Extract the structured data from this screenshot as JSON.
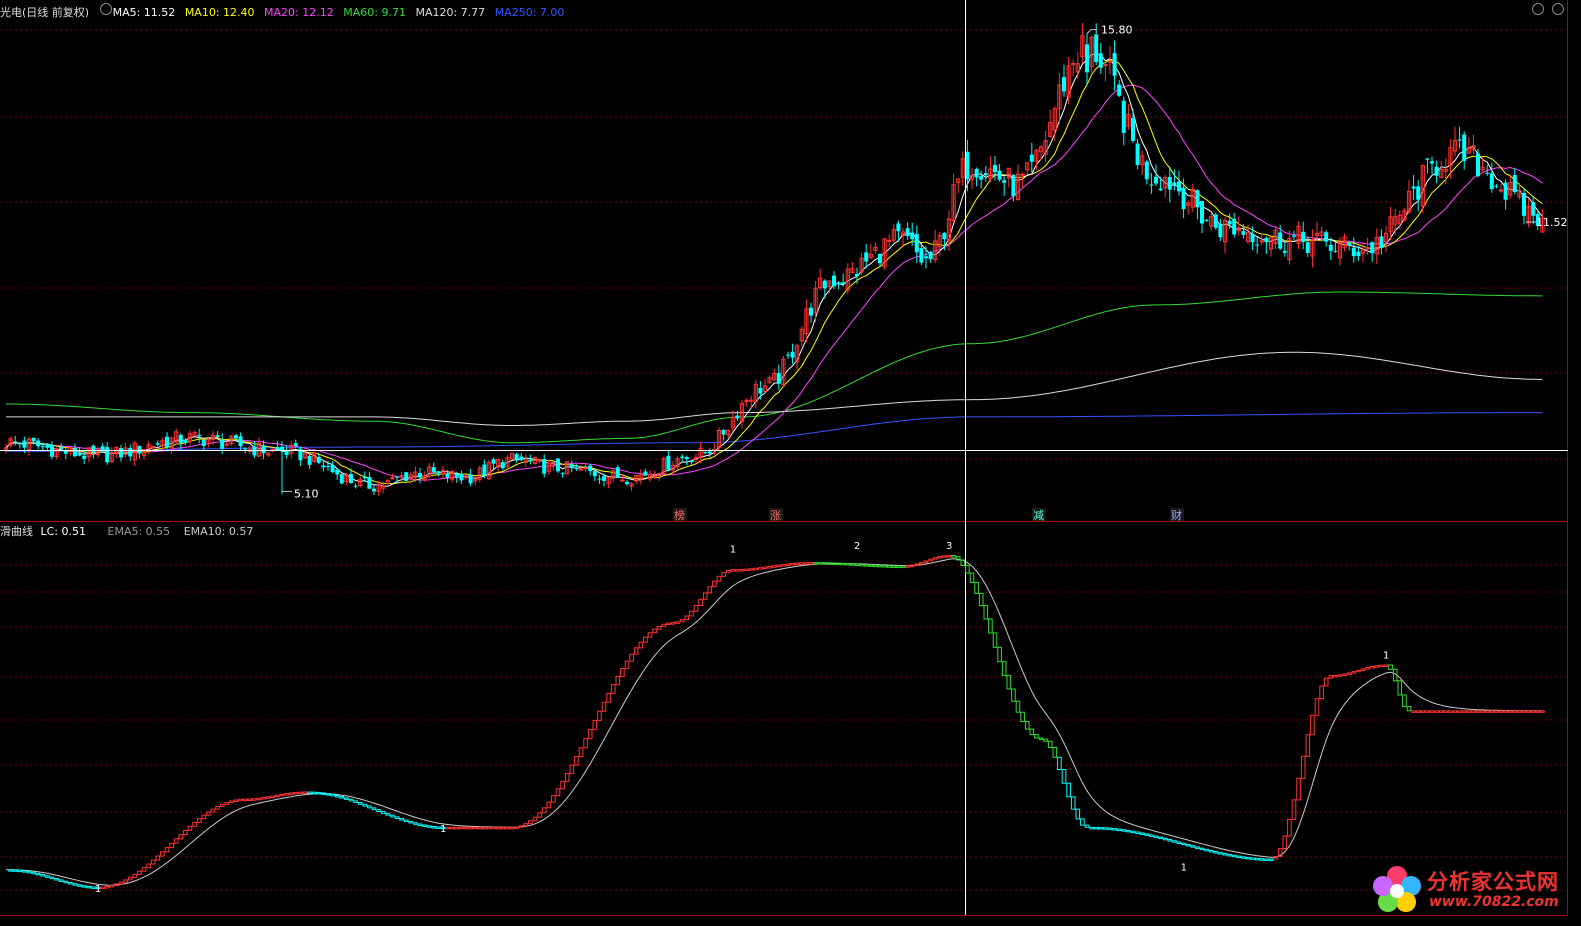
{
  "header": {
    "title": "光电(日线 前复权)",
    "ma": [
      {
        "label": "MA5: 11.52",
        "color": "#ffffff"
      },
      {
        "label": "MA10: 12.40",
        "color": "#ffff00"
      },
      {
        "label": "MA20: 12.12",
        "color": "#ff44ff"
      },
      {
        "label": "MA60: 9.71",
        "color": "#33dd33"
      },
      {
        "label": "MA120: 7.77",
        "color": "#dddddd"
      },
      {
        "label": "MA250: 7.00",
        "color": "#3355ff"
      }
    ]
  },
  "indicator": {
    "title": "滑曲线",
    "lc": "LC: 0.51",
    "ema5": "EMA5: 0.55",
    "ema10": "EMA10: 0.57"
  },
  "annotations": {
    "high": "15.80",
    "low": "5.10",
    "last": "11.52",
    "events": [
      "榜",
      "涨",
      "减",
      "财"
    ],
    "peaks": [
      "1",
      "2",
      "3",
      "1"
    ],
    "troughs": [
      "1",
      "1",
      "1"
    ]
  },
  "watermark": {
    "name": "分析家公式网",
    "url": "www.70822.com"
  },
  "colors": {
    "up": "#ff3333",
    "down": "#00ffff",
    "bg": "#000000",
    "grid": "#7a0000",
    "ma5": "#ffffff",
    "ma10": "#ffff00",
    "ma20": "#ff44ff",
    "ma60": "#33dd33",
    "ma120": "#dddddd",
    "ma250": "#3355ff",
    "osc_up": "#ff3333",
    "osc_down_green": "#33dd33",
    "osc_down_cyan": "#00ffff",
    "ema": "#cccccc"
  },
  "chart_data": {
    "type": "candlestick",
    "price_anchors": {
      "x": [
        0,
        20,
        40,
        60,
        80,
        90,
        100,
        110,
        120,
        135,
        150,
        165,
        180,
        195,
        200,
        210,
        220,
        235,
        250,
        265,
        280,
        295,
        315,
        335
      ],
      "close": [
        6.3,
        6.0,
        6.4,
        6.1,
        5.3,
        5.6,
        5.5,
        5.9,
        5.7,
        5.5,
        6.0,
        7.6,
        10.1,
        11.0,
        10.5,
        12.8,
        12.3,
        15.5,
        12.5,
        11.3,
        11.0,
        10.8,
        13.0,
        11.52
      ]
    },
    "ma_end_values": {
      "MA5": 11.52,
      "MA10": 12.4,
      "MA20": 12.12,
      "MA60": 9.71,
      "MA120": 7.77,
      "MA250": 7.0
    },
    "oscillator": {
      "x": [
        0,
        20,
        52,
        65,
        95,
        110,
        145,
        158,
        175,
        195,
        205,
        225,
        235,
        275,
        288,
        300,
        305
      ],
      "lc": [
        0.1,
        0.05,
        0.3,
        0.32,
        0.22,
        0.22,
        0.8,
        0.95,
        0.97,
        0.96,
        0.99,
        0.47,
        0.22,
        0.13,
        0.65,
        0.68,
        0.55
      ]
    }
  }
}
